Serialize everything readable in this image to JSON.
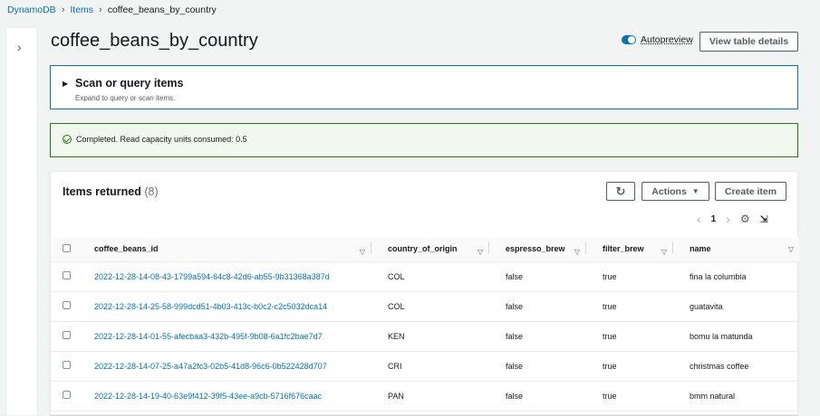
{
  "breadcrumb": {
    "root": "DynamoDB",
    "items": "Items",
    "current": "coffee_beans_by_country"
  },
  "page_title": "coffee_beans_by_country",
  "autopreview": {
    "label": "Autopreview",
    "enabled": true
  },
  "buttons": {
    "view_table_details": "View table details",
    "actions": "Actions",
    "create_item": "Create item"
  },
  "scan": {
    "title": "Scan or query items",
    "subtitle": "Expand to query or scan items."
  },
  "alert": {
    "message": "Completed. Read capacity units consumed: 0.5"
  },
  "items": {
    "title": "Items returned",
    "count": "(8)",
    "page": "1",
    "columns": [
      "coffee_beans_id",
      "country_of_origin",
      "espresso_brew",
      "filter_brew",
      "name"
    ],
    "rows": [
      [
        "2022-12-28-14-08-43-1799a594-64c8-42d6-ab55-9b31368a387d",
        "COL",
        "false",
        "true",
        "fina la columbia"
      ],
      [
        "2022-12-28-14-25-58-999dcd51-4b03-413c-b0c2-c2c5032dca14",
        "COL",
        "false",
        "true",
        "guatavita"
      ],
      [
        "2022-12-28-14-01-55-afecbaa3-432b-495f-9b08-6a1fc2bae7d7",
        "KEN",
        "false",
        "true",
        "bomu la matunda"
      ],
      [
        "2022-12-28-14-07-25-a47a2fc3-02b5-41d8-96c6-0b522428d707",
        "CRI",
        "false",
        "true",
        "christmas coffee"
      ],
      [
        "2022-12-28-14-19-40-63e9f412-39f5-43ee-a9cb-5716f676caac",
        "PAN",
        "false",
        "true",
        "bmm natural"
      ]
    ]
  },
  "colors": {
    "link": "#0073bb",
    "success": "#1d8102",
    "toggle_on": "#0073bb"
  }
}
